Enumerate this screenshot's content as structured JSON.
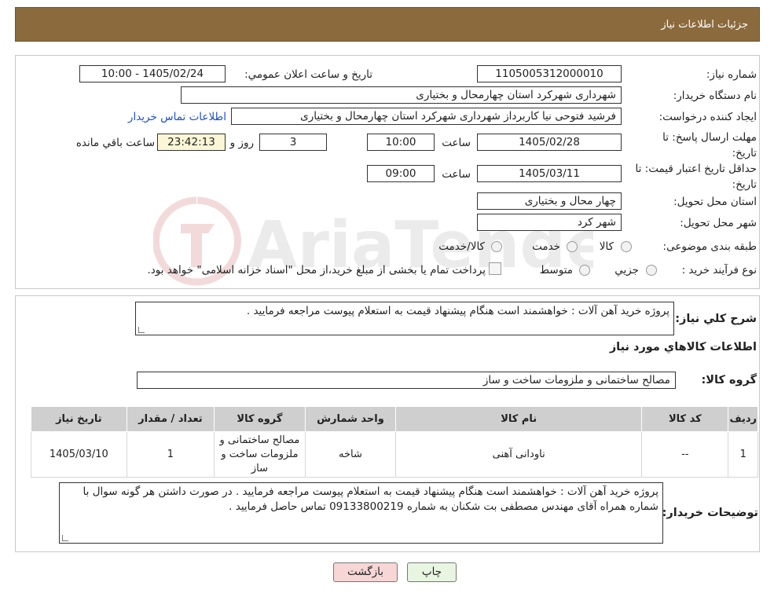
{
  "header": {
    "title": "جزئیات اطلاعات نیاز"
  },
  "form": {
    "need_number_label": "شماره نیاز:",
    "need_number": "1105005312000010",
    "announce_label": "تاریخ و ساعت اعلان عمومي:",
    "announce_value": "1405/02/24 - 10:00",
    "buyer_label": "نام دستگاه خريدار:",
    "buyer_value": "شهرداری شهرکرد استان چهارمحال و بختیاری",
    "creator_label": "ايجاد کننده درخواست:",
    "creator_value": "فرشید فتوحی نیا کاربرداز شهرداری شهرکرد استان چهارمحال و بختیاری",
    "contact_link": "اطلاعات تماس خريدار",
    "deadline_label": "مهلت ارسال پاسخ: تا تاریخ:",
    "deadline_date": "1405/02/28",
    "time_label": "ساعت",
    "deadline_time": "10:00",
    "days_value": "3",
    "days_label": "روز و",
    "remaining_time": "23:42:13",
    "remaining_label": "ساعت باقي مانده",
    "validity_label": "حداقل تاريخ اعتبار قيمت: تا تاريخ:",
    "validity_date": "1405/03/11",
    "validity_time": "09:00",
    "province_label": "استان محل تحويل:",
    "province_value": "چهار محال و بختیاری",
    "city_label": "شهر محل تحويل:",
    "city_value": "شهر کرد",
    "category_label": "طبقه بندی موضوعی:",
    "category_options": [
      "کالا",
      "خدمت",
      "کالا/خدمت"
    ],
    "process_label": "نوع فرآيند خريد :",
    "process_options": [
      "جزيي",
      "متوسط"
    ],
    "process_note": "پرداخت تمام يا بخشی از مبلغ خريد،از محل \"اسناد خزانه اسلامی\" خواهد بود."
  },
  "summary": {
    "desc_label": "شرح کلي نياز:",
    "desc_value": "پروژه خرید آهن آلات : خواهشمند است هنگام پیشنهاد قیمت به استعلام پیوست مراجعه فرمایید .",
    "goods_title": "اطلاعات کالاهاي مورد نياز",
    "group_label": "گروه کالا:",
    "group_value": "مصالح ساختمانی و ملزومات ساخت و ساز"
  },
  "table": {
    "headers": [
      "رديف",
      "کد کالا",
      "نام کالا",
      "واحد شمارش",
      "گروه کالا",
      "تعداد / مقدار",
      "تاريخ نياز"
    ],
    "rows": [
      {
        "row": "1",
        "code": "--",
        "name": "ناودانی آهنی",
        "unit": "شاخه",
        "group": "مصالح ساختمانی و ملزومات ساخت و ساز",
        "qty": "1",
        "date": "1405/03/10"
      }
    ]
  },
  "buyer_notes": {
    "label": "توضيحات خريدار:",
    "text": "پروژه خرید آهن آلات : خواهشمند است هنگام پیشنهاد قیمت به استعلام پیوست مراجعه فرمایید . در صورت داشتن هر گونه سوال با شماره همراه آقای مهندس مصطفی بت شکنان به شماره  09133800219 تماس حاصل فرمایید ."
  },
  "buttons": {
    "print": "چاپ",
    "back": "بازگشت"
  },
  "watermark": {
    "text": "AriaTender.neT"
  },
  "colors": {
    "header": "#8b6a3d",
    "back_button": "#f7d6d6",
    "print_button": "#e7f5e1"
  }
}
